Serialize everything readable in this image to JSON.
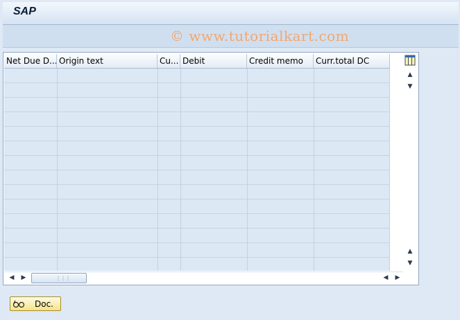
{
  "window": {
    "title": "SAP"
  },
  "watermark": "© www.tutorialkart.com",
  "table": {
    "columns": [
      "Net Due D...",
      "Origin text",
      "Cu...",
      "Debit",
      "Credit memo",
      "Curr.total DC"
    ],
    "row_count": 14
  },
  "icons": {
    "settings": "table-settings-icon",
    "scroll_up": "scroll-up-icon",
    "scroll_down": "scroll-down-icon",
    "scroll_left": "scroll-left-icon",
    "scroll_right": "scroll-right-icon",
    "doc": "glasses-display-icon"
  },
  "actions": {
    "doc_label": "Doc."
  },
  "colors": {
    "grid_body": "#dce8f4",
    "button_bg": "#f6e38a",
    "watermark": "#f0a770"
  }
}
